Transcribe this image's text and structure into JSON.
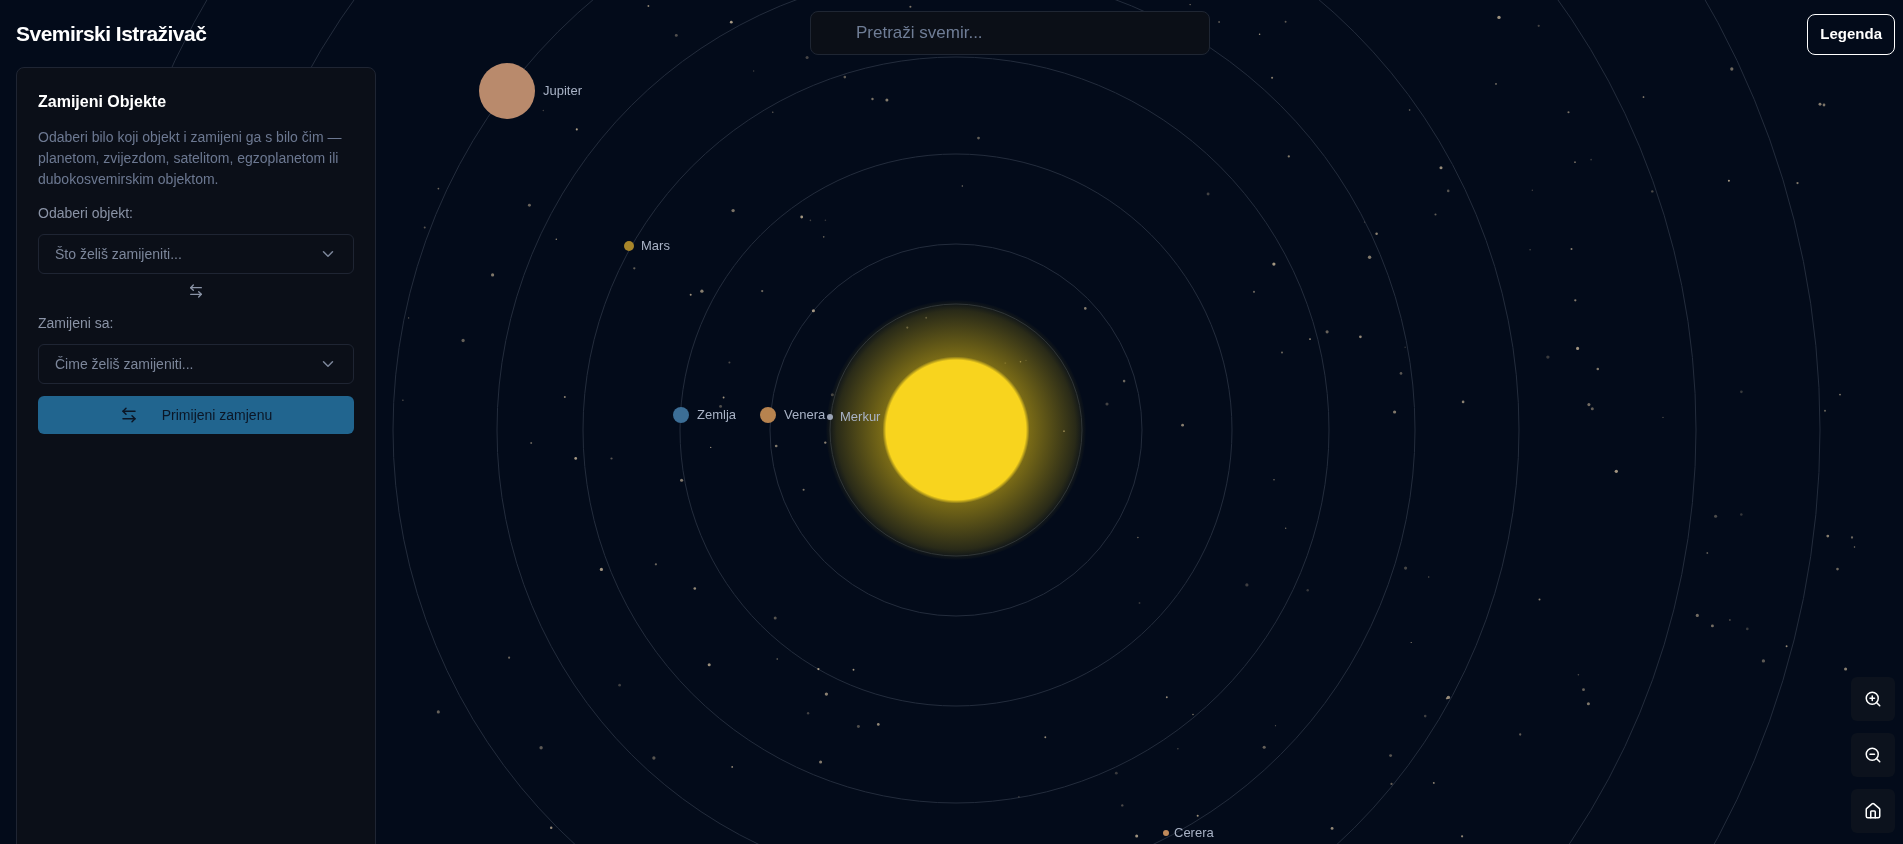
{
  "app": {
    "title": "Svemirski Istraživač"
  },
  "search": {
    "placeholder": "Pretraži svemir..."
  },
  "legend_button": {
    "label": "Legenda"
  },
  "swap_panel": {
    "title": "Zamijeni Objekte",
    "description": "Odaberi bilo koji objekt i zamijeni ga s bilo čim — planetom, zvijezdom, satelitom, egzoplanetom ili dubokosvemirskim objektom.",
    "source": {
      "label": "Odaberi objekt:",
      "placeholder": "Što želiš zamijeniti..."
    },
    "target": {
      "label": "Zamijeni sa:",
      "placeholder": "Čime želiš zamijeniti..."
    },
    "apply_button": {
      "label": "Primijeni zamjenu"
    }
  },
  "bodies": [
    {
      "name": "Jupiter",
      "color": "#b98a6c"
    },
    {
      "name": "Mars",
      "color": "#a8862a"
    },
    {
      "name": "Zemlja",
      "color": "#3c6e96"
    },
    {
      "name": "Venera",
      "color": "#b7834f"
    },
    {
      "name": "Merkur",
      "color": "#9aa3b5"
    },
    {
      "name": "Cerera",
      "color": "#c08a5a"
    }
  ]
}
